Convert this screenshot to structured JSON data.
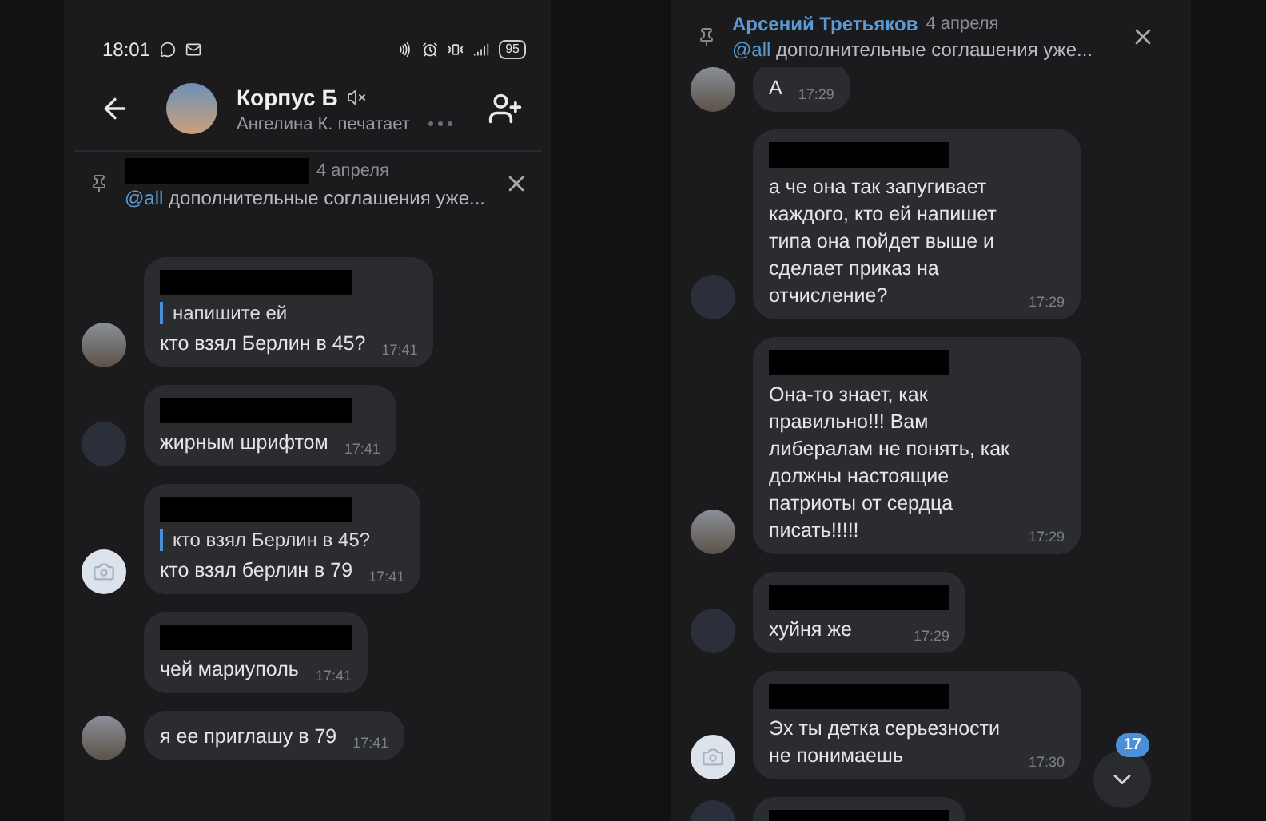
{
  "left": {
    "status_bar": {
      "time": "18:01",
      "battery": "95"
    },
    "header": {
      "title": "Корпус Б",
      "muted": true,
      "subtitle": "Ангелина К. печатает"
    },
    "pinned": {
      "date": "4 апреля",
      "mention": "@all",
      "text": "дополнительные соглашения уже..."
    },
    "messages": [
      {
        "kind": "photo",
        "redacted_name": true,
        "quote": "напишите ей",
        "text": "кто взял Берлин в 45?",
        "time": "17:41"
      },
      {
        "kind": "pattern",
        "redacted_name": true,
        "text": "жирным шрифтом",
        "time": "17:41"
      },
      {
        "kind": "camera",
        "redacted_name": true,
        "quote": "кто взял Берлин в 45?",
        "text": "кто взял берлин в 79",
        "time": "17:41"
      },
      {
        "kind": "none",
        "redacted_name": true,
        "text": "чей мариуполь",
        "time": "17:41"
      },
      {
        "kind": "photo",
        "redacted_name": false,
        "text": "я ее приглашу в 79",
        "time": "17:41"
      }
    ]
  },
  "right": {
    "pinned": {
      "author": "Арсений Третьяков",
      "date": "4 апреля",
      "mention": "@all",
      "text": "дополнительные соглашения уже..."
    },
    "messages": [
      {
        "kind": "photo",
        "redacted_name": false,
        "text": "А",
        "time": "17:29"
      },
      {
        "kind": "pattern",
        "redacted_name": true,
        "text": "а че она так запугивает каждого, кто ей напишет типа она пойдет выше и сделает приказ на отчисление?",
        "time": "17:29"
      },
      {
        "kind": "photo",
        "redacted_name": true,
        "text": "Она-то знает, как правильно!!! Вам либералам не понять, как должны настоящие патриоты от сердца писать!!!!!",
        "time": "17:29"
      },
      {
        "kind": "pattern",
        "redacted_name": true,
        "text": "хуйня же",
        "time": "17:29"
      },
      {
        "kind": "camera",
        "redacted_name": true,
        "text": "Эх ты детка серьезности не понимаешь",
        "time": "17:30"
      },
      {
        "kind": "pattern",
        "redacted_name": true
      }
    ],
    "scroll_button": {
      "badge": "17"
    }
  }
}
